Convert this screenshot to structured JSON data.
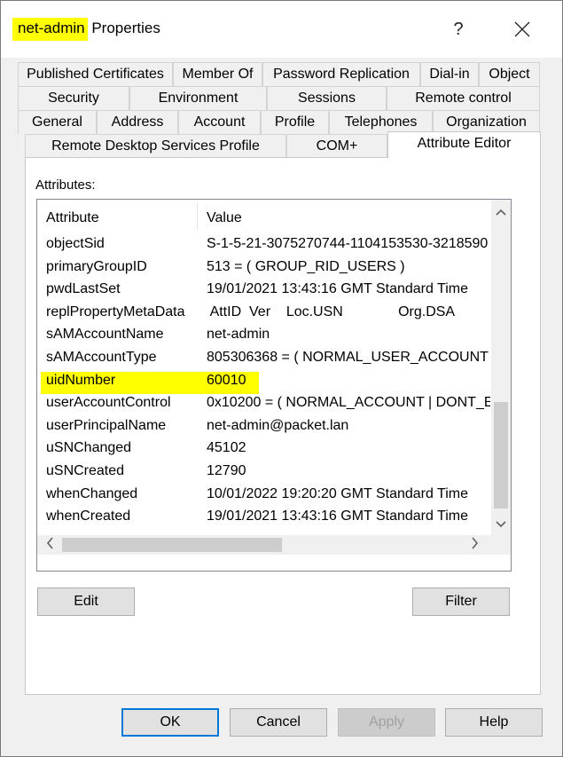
{
  "window": {
    "title_highlight": "net-admin",
    "title_rest": "Properties",
    "help_label": "?"
  },
  "tabs": {
    "row1": [
      "Published Certificates",
      "Member Of",
      "Password Replication",
      "Dial-in",
      "Object"
    ],
    "row2": [
      "Security",
      "Environment",
      "Sessions",
      "Remote control"
    ],
    "row3": [
      "General",
      "Address",
      "Account",
      "Profile",
      "Telephones",
      "Organization"
    ],
    "row4": [
      "Remote Desktop Services Profile",
      "COM+",
      "Attribute Editor"
    ]
  },
  "attributes": {
    "label": "Attributes:",
    "col_attribute": "Attribute",
    "col_value": "Value",
    "rows": [
      {
        "name": "objectSid",
        "value": "S-1-5-21-3075270744-1104153530-3218590"
      },
      {
        "name": "primaryGroupID",
        "value": "513 = ( GROUP_RID_USERS )"
      },
      {
        "name": "pwdLastSet",
        "value": "19/01/2021 13:43:16 GMT Standard Time"
      },
      {
        "name": "replPropertyMetaData",
        "value": " AttID  Ver    Loc.USN              Org.DSA"
      },
      {
        "name": "sAMAccountName",
        "value": "net-admin"
      },
      {
        "name": "sAMAccountType",
        "value": "805306368 = ( NORMAL_USER_ACCOUNT"
      },
      {
        "name": "uidNumber",
        "value": "60010"
      },
      {
        "name": "userAccountControl",
        "value": "0x10200 = ( NORMAL_ACCOUNT | DONT_E"
      },
      {
        "name": "userPrincipalName",
        "value": "net-admin@packet.lan"
      },
      {
        "name": "uSNChanged",
        "value": "45102"
      },
      {
        "name": "uSNCreated",
        "value": "12790"
      },
      {
        "name": "whenChanged",
        "value": "10/01/2022 19:20:20 GMT Standard Time"
      },
      {
        "name": "whenCreated",
        "value": "19/01/2021 13:43:16 GMT Standard Time"
      }
    ]
  },
  "buttons": {
    "edit": "Edit",
    "filter": "Filter",
    "ok": "OK",
    "cancel": "Cancel",
    "apply": "Apply",
    "help": "Help"
  },
  "colors": {
    "highlight": "#ffff00",
    "default_button_border": "#0078d7"
  }
}
